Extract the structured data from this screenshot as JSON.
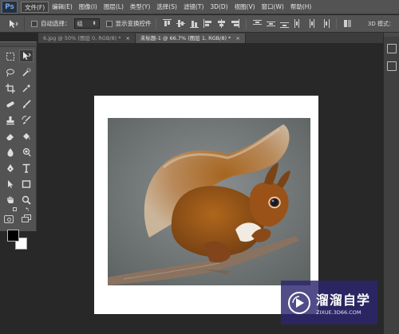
{
  "app": {
    "logo": "Ps"
  },
  "menu": [
    "文件(F)",
    "编辑(E)",
    "图像(I)",
    "图层(L)",
    "类型(Y)",
    "选择(S)",
    "滤镜(T)",
    "3D(D)",
    "视图(V)",
    "窗口(W)",
    "帮助(H)"
  ],
  "options": {
    "auto_select_label": "自动选择：",
    "auto_select_value": "组",
    "show_transform_label": "显示变换控件",
    "mode_3d_label": "3D 模式："
  },
  "tabs": [
    {
      "title": "6.jpg @ 50% (图层 0, RGB/8) *",
      "close": "×",
      "active": false
    },
    {
      "title": "未标题-1 @ 66.7% (图层 1, RGB/8) *",
      "close": "×",
      "active": true
    }
  ],
  "watermark": {
    "title": "溜溜自学",
    "url": "ZIXUE.3D66.COM"
  },
  "colors": {
    "foreground": "#000000",
    "background": "#ffffff",
    "chrome": "#535353",
    "workspace": "#282828",
    "watermark": "#2c266e"
  },
  "icons": [
    "marquee-icon",
    "move-icon",
    "lasso-icon",
    "quick-select-icon",
    "crop-icon",
    "eyedropper-icon",
    "healing-icon",
    "brush-icon",
    "clone-stamp-icon",
    "history-brush-icon",
    "eraser-icon",
    "paint-bucket-icon",
    "blur-icon",
    "dodge-icon",
    "pen-icon",
    "type-icon",
    "path-select-icon",
    "shape-icon",
    "hand-icon",
    "zoom-icon",
    "quick-mask-icon",
    "screen-mode-icon"
  ]
}
